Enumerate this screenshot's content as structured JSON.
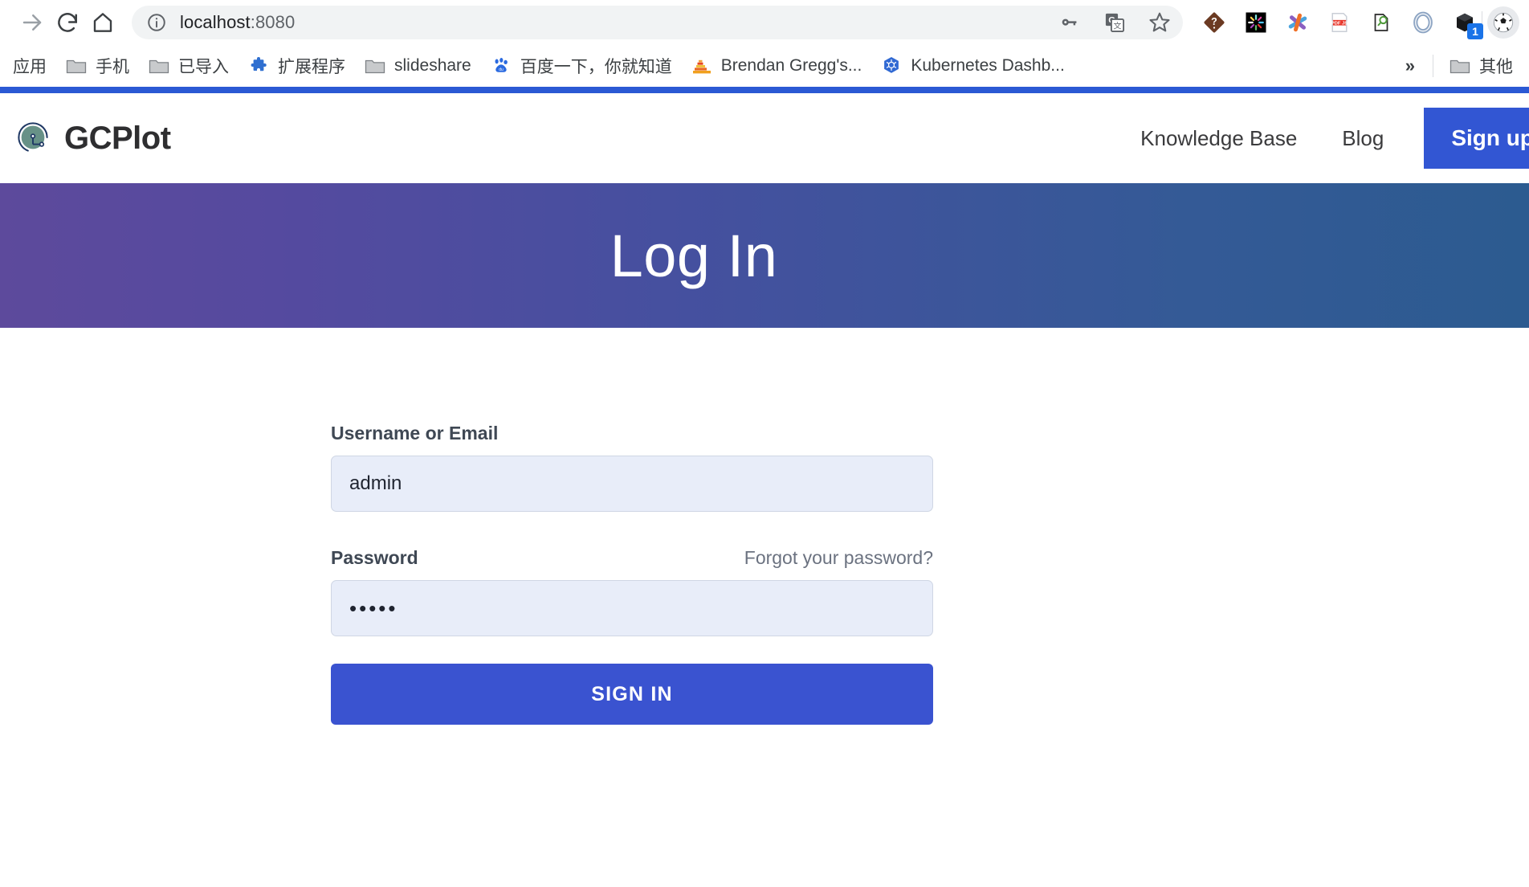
{
  "browser": {
    "toolbar": {
      "forward_icon": "forward-arrow-icon",
      "reload_icon": "reload-icon",
      "home_icon": "home-icon",
      "info_icon": "site-info-icon",
      "url_main": "localhost",
      "url_port": ":8080",
      "password_icon": "key-icon",
      "translate_icon": "google-translate-icon",
      "bookmark_icon": "star-icon"
    },
    "extensions": [
      {
        "name": "question-diamond-extension-icon"
      },
      {
        "name": "colorful-burst-extension-icon"
      },
      {
        "name": "asterisk-extension-icon"
      },
      {
        "name": "pdf-js-extension-icon"
      },
      {
        "name": "magnifier-document-extension-icon"
      },
      {
        "name": "blue-ring-extension-icon"
      },
      {
        "name": "black-box-extension-icon",
        "badge": "1"
      }
    ],
    "avatar_icon": "soccer-ball-avatar",
    "bookmarks": [
      {
        "label": "应用",
        "icon": "apps-icon"
      },
      {
        "label": "手机",
        "icon": "folder-icon"
      },
      {
        "label": "已导入",
        "icon": "folder-icon"
      },
      {
        "label": "扩展程序",
        "icon": "puzzle-icon"
      },
      {
        "label": "slideshare",
        "icon": "folder-icon"
      },
      {
        "label": "百度一下，你就知道",
        "icon": "baidu-icon"
      },
      {
        "label": "Brendan Gregg's...",
        "icon": "flamegraph-icon"
      },
      {
        "label": "Kubernetes Dashb...",
        "icon": "kubernetes-icon"
      }
    ],
    "bookmarks_overflow": "»",
    "bookmarks_other": {
      "label": "其他",
      "icon": "folder-icon"
    }
  },
  "site": {
    "brand": "GCPlot",
    "logo_icon": "gcplot-logo-icon",
    "nav": [
      {
        "label": "Knowledge Base"
      },
      {
        "label": "Blog"
      }
    ],
    "signup_label": "Sign up",
    "banner_title": "Log In"
  },
  "login_form": {
    "username_label": "Username or Email",
    "username_value": "admin",
    "username_placeholder": "Username or Email",
    "password_label": "Password",
    "password_value": "•••••",
    "password_placeholder": "Password",
    "forgot_label": "Forgot your password?",
    "submit_label": "SIGN IN"
  },
  "colors": {
    "accent_blue": "#3256d3",
    "banner_left": "#5d4a9c",
    "banner_right": "#2c5b90",
    "input_bg": "#e8edf9",
    "logo_green": "#679187",
    "logo_navy": "#1f3864"
  }
}
